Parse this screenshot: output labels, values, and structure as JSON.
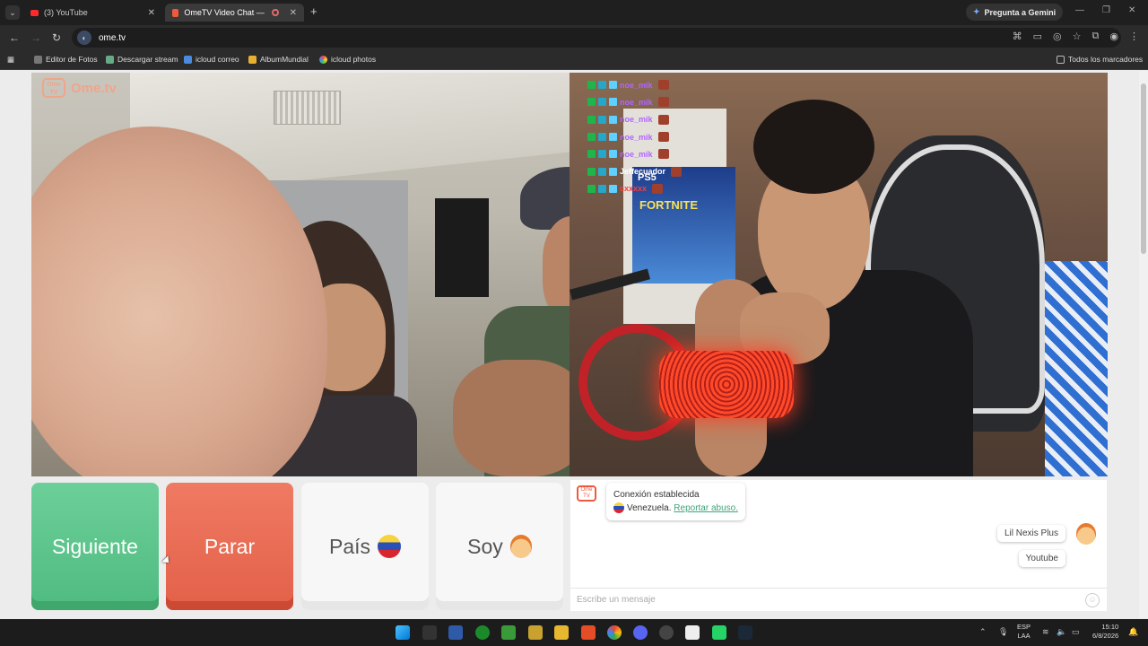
{
  "browser": {
    "tabs": [
      {
        "title": "(3) YouTube",
        "active": false
      },
      {
        "title": "OmeTV Video Chat — Ome",
        "active": true
      }
    ],
    "gemini_button": "Pregunta a Gemini",
    "url": "ome.tv",
    "bookmarks": [
      "Editor de Fotos",
      "Descargar stream",
      "icloud correo",
      "AlbumMundial",
      "icloud photos"
    ],
    "all_bookmarks": "Todos los marcadores"
  },
  "stream_overlay": {
    "names": [
      "noe_mik",
      "noe_mik",
      "noe_mik",
      "noe_mik",
      "noe_mik",
      "Jeffecuador",
      "cxxxxx"
    ],
    "name_colors": [
      "#b066ff",
      "#b066ff",
      "#b066ff",
      "#b066ff",
      "#b066ff",
      "#ffffff",
      "#ff3b3b"
    ]
  },
  "page": {
    "logo_text": "Ome.tv",
    "logo_badge": "Ome TV",
    "buttons": {
      "next": "Siguiente",
      "stop": "Parar",
      "country": "País",
      "me": "Soy"
    },
    "chat": {
      "system_line1": "Conexión establecida",
      "system_country": "Venezuela.",
      "report_link": "Reportar abuso.",
      "sent_messages": [
        "Lil Nexis Plus",
        "Youtube"
      ],
      "input_placeholder": "Escribe un mensaje"
    }
  },
  "taskbar": {
    "lang_line1": "ESP",
    "lang_line2": "LAA",
    "time": "15:10",
    "date": "6/8/2026"
  },
  "colors": {
    "next_green": "#5cc48b",
    "stop_red": "#e8684f",
    "accent_link": "#3ea57b"
  }
}
